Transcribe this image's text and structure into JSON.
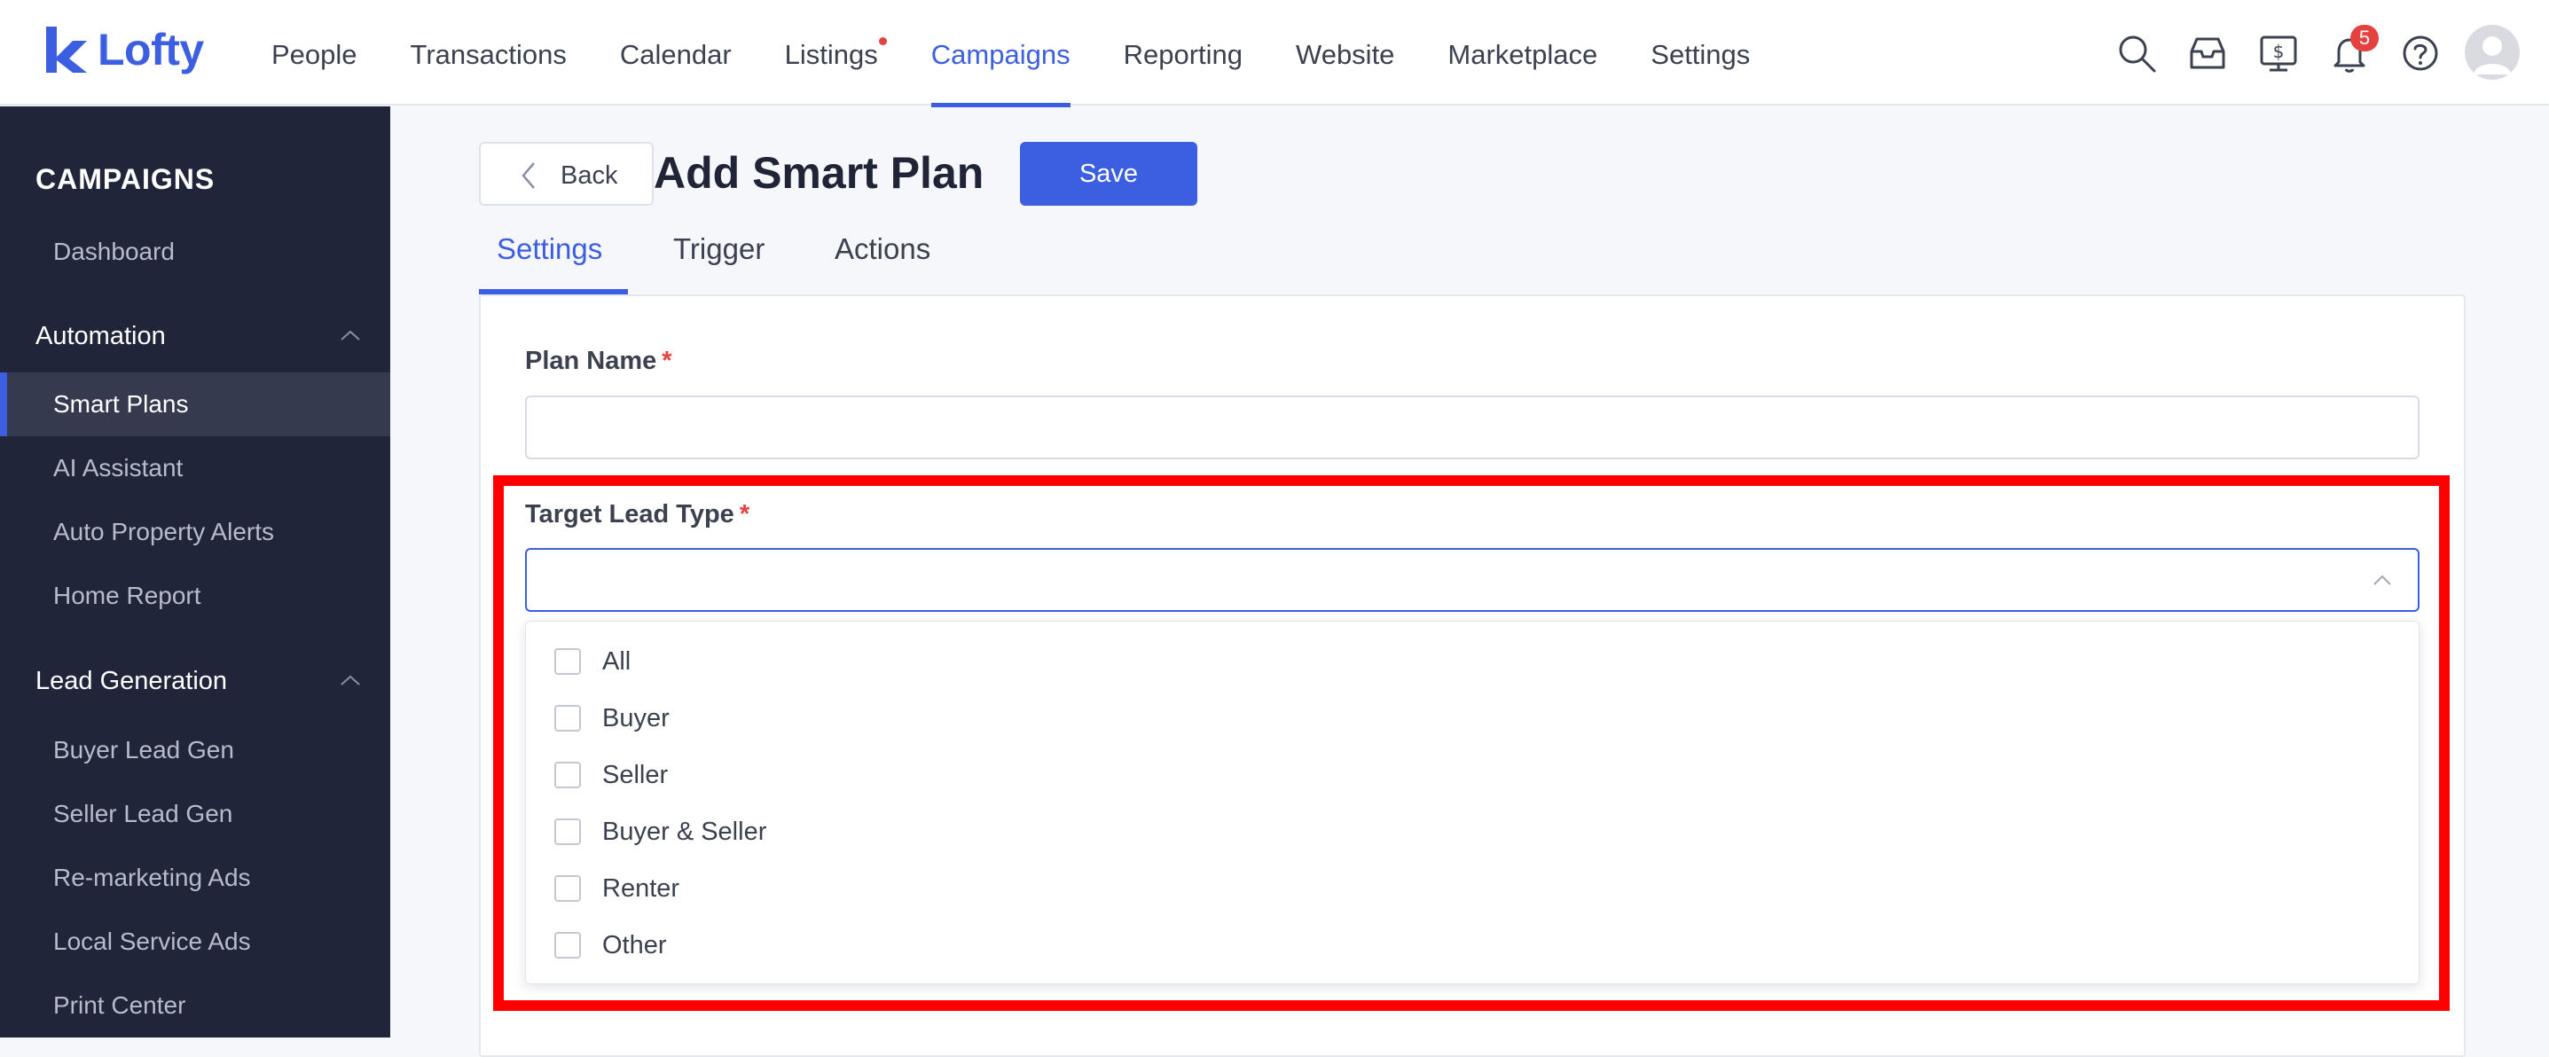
{
  "app": {
    "name": "Lofty",
    "brand_color": "#3c5ee0"
  },
  "nav": {
    "items": [
      {
        "label": "People"
      },
      {
        "label": "Transactions"
      },
      {
        "label": "Calendar"
      },
      {
        "label": "Listings"
      },
      {
        "label": "Campaigns"
      },
      {
        "label": "Reporting"
      },
      {
        "label": "Website"
      },
      {
        "label": "Marketplace"
      },
      {
        "label": "Settings"
      }
    ],
    "active": "Campaigns"
  },
  "toolbar": {
    "icons": [
      "search-icon",
      "inbox-icon",
      "billing-icon",
      "bell-icon",
      "help-icon",
      "avatar"
    ],
    "notification_count": "5"
  },
  "sidebar": {
    "title": "CAMPAIGNS",
    "top_items": [
      {
        "label": "Dashboard"
      }
    ],
    "groups": [
      {
        "label": "Automation",
        "items": [
          {
            "label": "Smart Plans",
            "active": true
          },
          {
            "label": "AI Assistant"
          },
          {
            "label": "Auto Property Alerts"
          },
          {
            "label": "Home Report"
          }
        ]
      },
      {
        "label": "Lead Generation",
        "items": [
          {
            "label": "Buyer Lead Gen"
          },
          {
            "label": "Seller Lead Gen"
          },
          {
            "label": "Re-marketing Ads"
          },
          {
            "label": "Local Service Ads"
          },
          {
            "label": "Print Center"
          }
        ]
      }
    ]
  },
  "header": {
    "back_label": "Back",
    "title": "Add Smart Plan",
    "save_label": "Save"
  },
  "tabs": [
    {
      "label": "Settings",
      "active": true
    },
    {
      "label": "Trigger"
    },
    {
      "label": "Actions"
    }
  ],
  "form": {
    "plan_name": {
      "label": "Plan Name",
      "required_mark": "*",
      "value": ""
    },
    "target_lead_type": {
      "label": "Target Lead Type",
      "required_mark": "*",
      "value": "",
      "options": [
        {
          "label": "All",
          "checked": false
        },
        {
          "label": "Buyer",
          "checked": false
        },
        {
          "label": "Seller",
          "checked": false
        },
        {
          "label": "Buyer & Seller",
          "checked": false
        },
        {
          "label": "Renter",
          "checked": false
        },
        {
          "label": "Other",
          "checked": false
        }
      ]
    }
  },
  "colors": {
    "sidebar_bg": "#20253a",
    "accent": "#3c5ee0",
    "required": "#e5413f",
    "highlight": "#ff0000"
  }
}
